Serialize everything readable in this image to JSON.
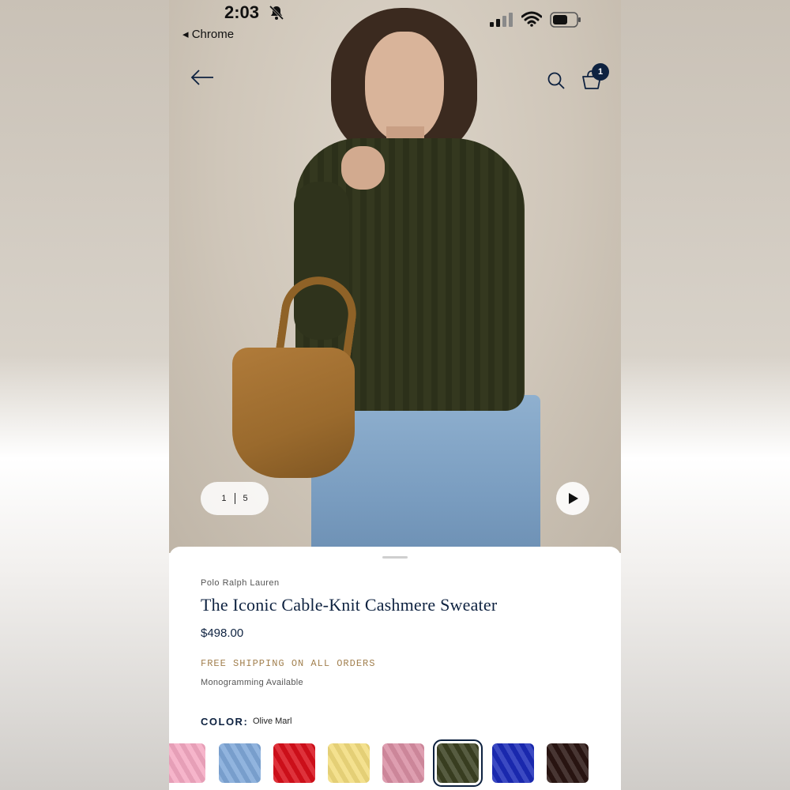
{
  "status_bar": {
    "time": "2:03",
    "back_app": "◂ Chrome",
    "icons": [
      "bell-slash-icon",
      "signal-icon",
      "wifi-icon",
      "battery-icon"
    ]
  },
  "nav": {
    "icons": [
      "back-arrow-icon",
      "search-icon",
      "shopping-bag-icon"
    ],
    "bag_count": "1"
  },
  "gallery": {
    "current": "1",
    "total": "5",
    "play_icon": "play-icon"
  },
  "product": {
    "brand": "Polo Ralph Lauren",
    "title": "The Iconic Cable-Knit Cashmere Sweater",
    "price": "$498.00",
    "shipping": "FREE SHIPPING ON ALL ORDERS",
    "monogram": "Monogramming Available",
    "color_label": "COLOR:",
    "color_value": "Olive Marl"
  },
  "swatches": [
    {
      "color": "#f4a9c2",
      "selected": false
    },
    {
      "color": "#7fa8d9",
      "selected": false
    },
    {
      "color": "#d8101b",
      "selected": false
    },
    {
      "color": "#f2dc7d",
      "selected": false
    },
    {
      "color": "#d98ea3",
      "selected": false
    },
    {
      "color": "#3b4122",
      "selected": true
    },
    {
      "color": "#1b2bb8",
      "selected": false
    },
    {
      "color": "#2a1512",
      "selected": false
    }
  ],
  "colors": {
    "navy": "#0e2240",
    "shipping_gold": "#a2804f"
  }
}
